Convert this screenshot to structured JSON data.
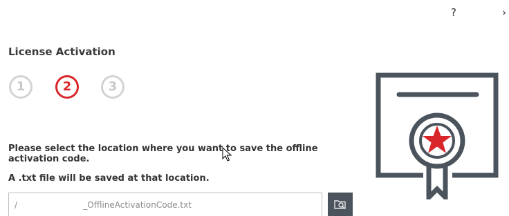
{
  "window": {
    "help_label": "?",
    "close_label": "›"
  },
  "page": {
    "title": "License Activation"
  },
  "steps": [
    {
      "label": "1",
      "state": "inactive"
    },
    {
      "label": "2",
      "state": "active"
    },
    {
      "label": "3",
      "state": "inactive"
    }
  ],
  "instructions": {
    "main": "Please select the location where you want to save the offline activation code.",
    "note": "A .txt file will be saved at that location."
  },
  "save_location": {
    "value": "/                         _OfflineActivationCode.txt"
  },
  "browse": {
    "icon": "folder-search-icon"
  },
  "illustration": {
    "icon": "certificate-icon"
  },
  "colors": {
    "accent": "#d9262a",
    "inactive_step": "#d3d3d3",
    "dark_gray": "#4b545c",
    "text": "#333333"
  }
}
